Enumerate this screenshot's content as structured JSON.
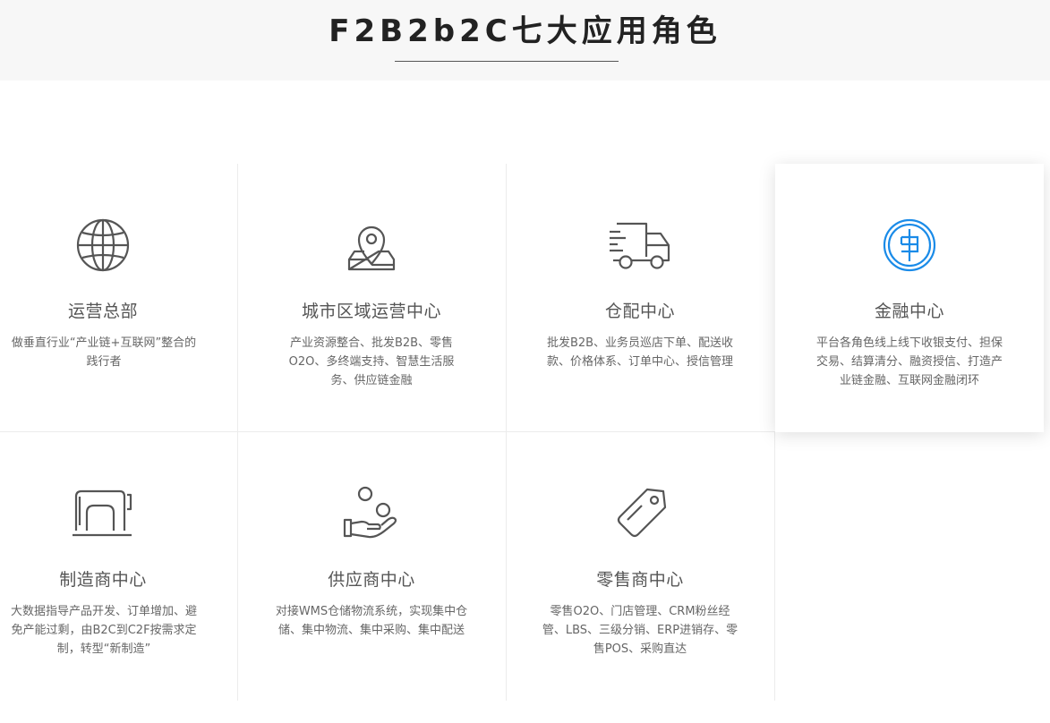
{
  "header": {
    "title": "F2B2b2C七大应用角色"
  },
  "roles": [
    {
      "title": "运营总部",
      "desc": "做垂直行业“产业链+互联网”整合的践行者",
      "icon": "globe-icon"
    },
    {
      "title": "城市区域运营中心",
      "desc": "产业资源整合、批发B2B、零售O2O、多终端支持、智慧生活服务、供应链金融",
      "icon": "map-pin-icon"
    },
    {
      "title": "仓配中心",
      "desc": "批发B2B、业务员巡店下单、配送收款、价格体系、订单中心、授信管理",
      "icon": "delivery-truck-icon"
    },
    {
      "title": "金融中心",
      "desc": "平台各角色线上线下收银支付、担保交易、结算清分、融资授信、打造产业链金融、互联网金融闭环",
      "icon": "coin-icon"
    },
    {
      "title": "制造商中心",
      "desc": "大数据指导产品开发、订单增加、避免产能过剩，由B2C到C2F按需求定制，转型“新制造”",
      "icon": "sewing-machine-icon"
    },
    {
      "title": "供应商中心",
      "desc": "对接WMS仓储物流系统，实现集中仓储、集中物流、集中采购、集中配送",
      "icon": "hand-coins-icon"
    },
    {
      "title": "零售商中心",
      "desc": "零售O2O、门店管理、CRM粉丝经管、LBS、三级分销、ERP进销存、零售POS、采购直达",
      "icon": "price-tag-icon"
    }
  ],
  "colors": {
    "icon_default": "#555555",
    "icon_active": "#1a8be8",
    "hero_bg": "#f7f7f7"
  }
}
